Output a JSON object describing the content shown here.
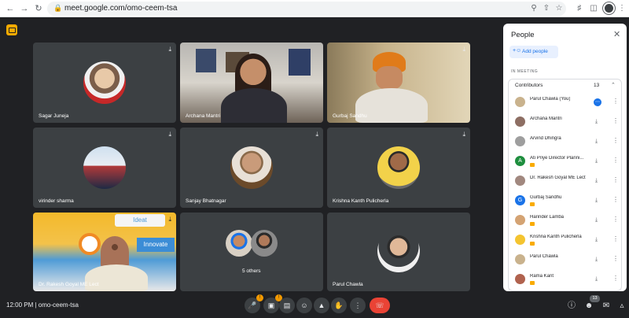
{
  "browser": {
    "url": "meet.google.com/omo-ceem-tsa"
  },
  "tiles": [
    {
      "name": "Sagar Juneja",
      "muted": true
    },
    {
      "name": "Archana Mantri",
      "muted": false
    },
    {
      "name": "Gurbaj Sandhu",
      "muted": true
    },
    {
      "name": "virinder sharma",
      "muted": true
    },
    {
      "name": "Sanjay Bhatnagar",
      "muted": true
    },
    {
      "name": "Krishna Kanth Pulicherla",
      "muted": true
    },
    {
      "name": "Dr. Rakesh Goyal ME Lect",
      "muted": true
    },
    {
      "name": "5 others",
      "muted": false
    },
    {
      "name": "Parul Chawla",
      "muted": false
    }
  ],
  "bottom_bar": {
    "time": "12:00 PM",
    "separator": "|",
    "meeting_code": "omo-ceem-tsa",
    "participant_count": "13",
    "mic_badge": "!",
    "cam_badge": "!"
  },
  "panel": {
    "title": "People",
    "add_people": "Add people",
    "section": "IN MEETING",
    "group_label": "Contributors",
    "group_count": "13",
    "people": [
      {
        "name": "Parul Chawla (You)",
        "initial": "",
        "avatar_color": "#c9b28d",
        "presenting": false
      },
      {
        "name": "Archana Mantri",
        "initial": "",
        "avatar_color": "#8d6e63",
        "presenting": false
      },
      {
        "name": "Arvind Dhingra",
        "initial": "",
        "avatar_color": "#9e9e9e",
        "presenting": false
      },
      {
        "name": "Ati Priye Director Planni...",
        "initial": "A",
        "avatar_color": "#1e8e3e",
        "presenting": true
      },
      {
        "name": "Dr. Rakesh Goyal ME Lect",
        "initial": "",
        "avatar_color": "#a1887f",
        "presenting": false
      },
      {
        "name": "Gurbaj Sandhu",
        "initial": "G",
        "avatar_color": "#1a73e8",
        "presenting": true
      },
      {
        "name": "Harinder Lamba",
        "initial": "",
        "avatar_color": "#d4a373",
        "presenting": true
      },
      {
        "name": "Krishna Kanth Pulicherla",
        "initial": "",
        "avatar_color": "#f4c430",
        "presenting": true
      },
      {
        "name": "Parul Chawla",
        "initial": "",
        "avatar_color": "#c9b28d",
        "presenting": false
      },
      {
        "name": "Rama Kant",
        "initial": "",
        "avatar_color": "#b0624e",
        "presenting": true
      }
    ]
  },
  "colors": {
    "background": "#202124",
    "tile": "#3c4043",
    "accent": "#1a73e8",
    "end_call": "#ea4335"
  }
}
